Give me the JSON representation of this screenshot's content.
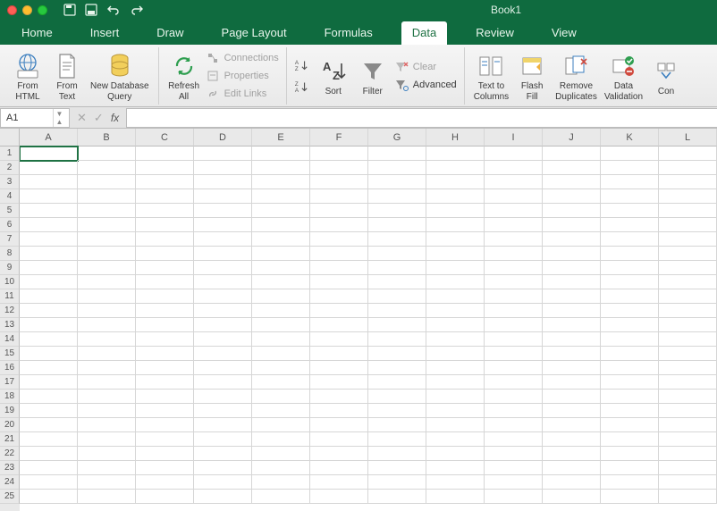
{
  "titlebar": {
    "title": "Book1"
  },
  "tabs": [
    "Home",
    "Insert",
    "Draw",
    "Page Layout",
    "Formulas",
    "Data",
    "Review",
    "View"
  ],
  "tabs_active": 5,
  "ribbon": {
    "get_external": {
      "from_html": "From\nHTML",
      "from_text": "From\nText",
      "db_query": "New Database\nQuery"
    },
    "connections": {
      "refresh_all": "Refresh\nAll",
      "connections": "Connections",
      "properties": "Properties",
      "edit_links": "Edit Links"
    },
    "sort_filter": {
      "sort": "Sort",
      "filter": "Filter",
      "clear": "Clear",
      "advanced": "Advanced"
    },
    "data_tools": {
      "text_to_columns": "Text to\nColumns",
      "flash_fill": "Flash\nFill",
      "remove_dup": "Remove\nDuplicates",
      "data_validation": "Data\nValidation",
      "consolidate": "Con"
    }
  },
  "formula_bar": {
    "cell_ref": "A1",
    "formula": ""
  },
  "columns": [
    "A",
    "B",
    "C",
    "D",
    "E",
    "F",
    "G",
    "H",
    "I",
    "J",
    "K",
    "L"
  ],
  "rows": [
    "1",
    "2",
    "3",
    "4",
    "5",
    "6",
    "7",
    "8",
    "9",
    "10",
    "11",
    "12",
    "13",
    "14",
    "15",
    "16",
    "17",
    "18",
    "19",
    "20",
    "21",
    "22",
    "23",
    "24",
    "25"
  ],
  "selected": {
    "col": 0,
    "row": 0
  }
}
